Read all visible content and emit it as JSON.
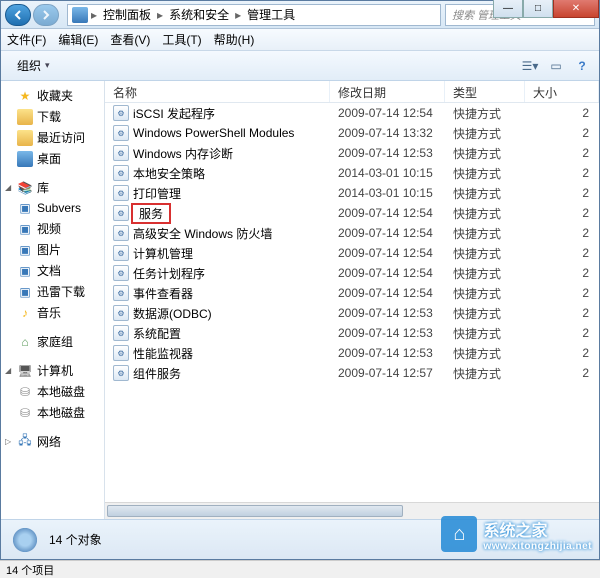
{
  "window": {
    "breadcrumb": [
      "控制面板",
      "系统和安全",
      "管理工具"
    ],
    "search_placeholder": "搜索 管理工具",
    "win_min": "—",
    "win_max": "□",
    "win_close": "✕"
  },
  "menu": {
    "file": "文件(F)",
    "edit": "编辑(E)",
    "view": "查看(V)",
    "tools": "工具(T)",
    "help": "帮助(H)"
  },
  "toolbar": {
    "organize": "组织"
  },
  "sidebar": {
    "favorites": {
      "label": "收藏夹",
      "items": [
        "下载",
        "最近访问",
        "桌面"
      ]
    },
    "libraries": {
      "label": "库",
      "items": [
        "Subvers",
        "视频",
        "图片",
        "文档",
        "迅雷下载",
        "音乐"
      ]
    },
    "homegroup": {
      "label": "家庭组"
    },
    "computer": {
      "label": "计算机",
      "items": [
        "本地磁盘",
        "本地磁盘"
      ]
    },
    "network": {
      "label": "网络"
    }
  },
  "columns": {
    "name": "名称",
    "date": "修改日期",
    "type": "类型",
    "size": "大小"
  },
  "files": [
    {
      "name": "iSCSI 发起程序",
      "date": "2009-07-14 12:54",
      "type": "快捷方式",
      "size": "2"
    },
    {
      "name": "Windows PowerShell Modules",
      "date": "2009-07-14 13:32",
      "type": "快捷方式",
      "size": "2"
    },
    {
      "name": "Windows 内存诊断",
      "date": "2009-07-14 12:53",
      "type": "快捷方式",
      "size": "2"
    },
    {
      "name": "本地安全策略",
      "date": "2014-03-01 10:15",
      "type": "快捷方式",
      "size": "2"
    },
    {
      "name": "打印管理",
      "date": "2014-03-01 10:15",
      "type": "快捷方式",
      "size": "2"
    },
    {
      "name": "服务",
      "date": "2009-07-14 12:54",
      "type": "快捷方式",
      "size": "2",
      "highlighted": true
    },
    {
      "name": "高级安全 Windows 防火墙",
      "date": "2009-07-14 12:54",
      "type": "快捷方式",
      "size": "2"
    },
    {
      "name": "计算机管理",
      "date": "2009-07-14 12:54",
      "type": "快捷方式",
      "size": "2"
    },
    {
      "name": "任务计划程序",
      "date": "2009-07-14 12:54",
      "type": "快捷方式",
      "size": "2"
    },
    {
      "name": "事件查看器",
      "date": "2009-07-14 12:54",
      "type": "快捷方式",
      "size": "2"
    },
    {
      "name": "数据源(ODBC)",
      "date": "2009-07-14 12:53",
      "type": "快捷方式",
      "size": "2"
    },
    {
      "name": "系统配置",
      "date": "2009-07-14 12:53",
      "type": "快捷方式",
      "size": "2"
    },
    {
      "name": "性能监视器",
      "date": "2009-07-14 12:53",
      "type": "快捷方式",
      "size": "2"
    },
    {
      "name": "组件服务",
      "date": "2009-07-14 12:57",
      "type": "快捷方式",
      "size": "2"
    }
  ],
  "status": {
    "count": "14 个对象"
  },
  "bottom_status": "14 个项目",
  "watermark": {
    "brand": "系统之家",
    "url": "www.xitongzhijia.net"
  }
}
